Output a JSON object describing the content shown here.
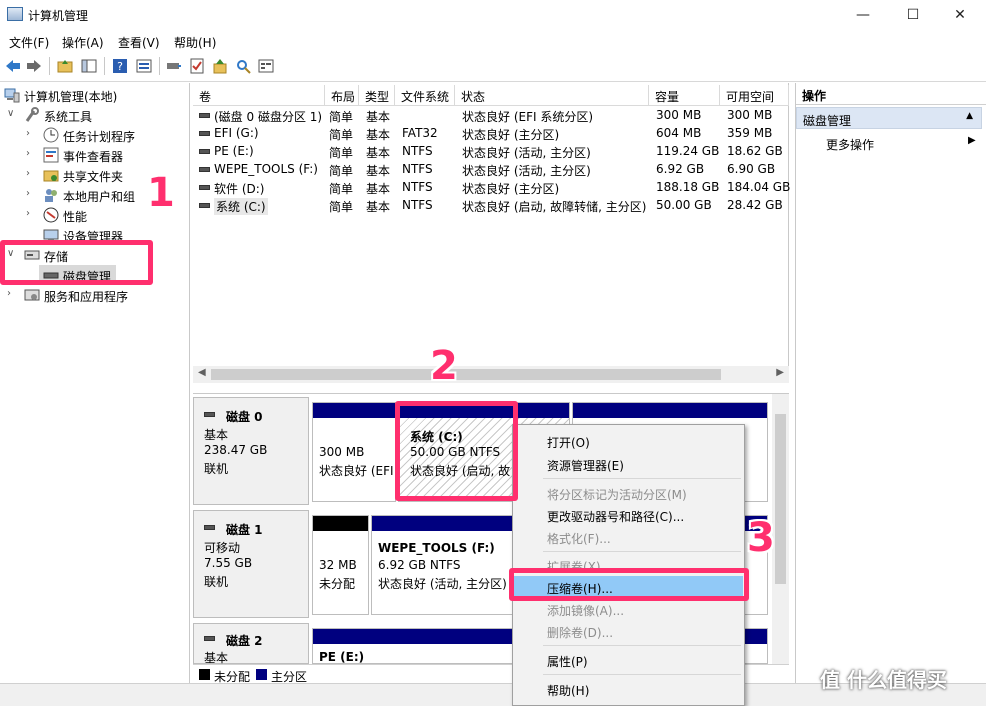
{
  "window": {
    "title": "计算机管理",
    "minimize": "—",
    "maximize": "☐",
    "close": "✕"
  },
  "menu": [
    "文件(F)",
    "操作(A)",
    "查看(V)",
    "帮助(H)"
  ],
  "tree": {
    "root": "计算机管理(本地)",
    "system_tools": "系统工具",
    "task_scheduler": "任务计划程序",
    "event_viewer": "事件查看器",
    "shared_folders": "共享文件夹",
    "local_users": "本地用户和组",
    "performance": "性能",
    "device_manager": "设备管理器",
    "storage": "存储",
    "disk_management": "磁盘管理",
    "services_apps": "服务和应用程序"
  },
  "volume_table": {
    "columns": [
      "卷",
      "布局",
      "类型",
      "文件系统",
      "状态",
      "容量",
      "可用空间"
    ],
    "rows": [
      [
        "(磁盘 0 磁盘分区 1)",
        "简单",
        "基本",
        "",
        "状态良好 (EFI 系统分区)",
        "300 MB",
        "300 MB"
      ],
      [
        "EFI (G:)",
        "简单",
        "基本",
        "FAT32",
        "状态良好 (主分区)",
        "604 MB",
        "359 MB"
      ],
      [
        "PE (E:)",
        "简单",
        "基本",
        "NTFS",
        "状态良好 (活动, 主分区)",
        "119.24 GB",
        "18.62 GB"
      ],
      [
        "WEPE_TOOLS (F:)",
        "简单",
        "基本",
        "NTFS",
        "状态良好 (活动, 主分区)",
        "6.92 GB",
        "6.90 GB"
      ],
      [
        "软件 (D:)",
        "简单",
        "基本",
        "NTFS",
        "状态良好 (主分区)",
        "188.18 GB",
        "184.04 GB"
      ],
      [
        "系统 (C:)",
        "简单",
        "基本",
        "NTFS",
        "状态良好 (启动, 故障转储, 主分区)",
        "50.00 GB",
        "28.42 GB"
      ]
    ]
  },
  "disks": [
    {
      "name": "磁盘 0",
      "type": "基本",
      "size": "238.47 GB",
      "status": "联机",
      "partitions": [
        {
          "line1": "",
          "line2": "300 MB",
          "line3": "状态良好 (EFI"
        },
        {
          "line1": "系统  (C:)",
          "line2": "50.00 GB NTFS",
          "line3": "状态良好 (启动, 故"
        }
      ]
    },
    {
      "name": "磁盘 1",
      "type": "可移动",
      "size": "7.55 GB",
      "status": "联机",
      "partitions": [
        {
          "line1": "",
          "line2": "32 MB",
          "line3": "未分配"
        },
        {
          "line1": "WEPE_TOOLS  (F:)",
          "line2": "6.92 GB NTFS",
          "line3": "状态良好 (活动, 主分区)"
        }
      ]
    },
    {
      "name": "磁盘 2",
      "type": "基本",
      "partitions": [
        {
          "line1": "PE  (E:)"
        }
      ]
    }
  ],
  "legend": {
    "unallocated": "未分配",
    "primary": "主分区"
  },
  "actions": {
    "header": "操作",
    "section": "磁盘管理",
    "more": "更多操作"
  },
  "context_menu": [
    {
      "label": "打开(O)",
      "enabled": true
    },
    {
      "label": "资源管理器(E)",
      "enabled": true
    },
    {
      "label": "将分区标记为活动分区(M)",
      "enabled": false
    },
    {
      "label": "更改驱动器号和路径(C)...",
      "enabled": true
    },
    {
      "label": "格式化(F)...",
      "enabled": false
    },
    {
      "label": "扩展卷(X)...",
      "enabled": false
    },
    {
      "label": "压缩卷(H)...",
      "enabled": true
    },
    {
      "label": "添加镜像(A)...",
      "enabled": false
    },
    {
      "label": "删除卷(D)...",
      "enabled": false
    },
    {
      "label": "属性(P)",
      "enabled": true
    },
    {
      "label": "帮助(H)",
      "enabled": true
    }
  ],
  "annotations": {
    "step1": "1",
    "step2": "2",
    "step3": "3"
  },
  "watermark": "值 什么值得买",
  "colors": {
    "primary_partition": "#00007f",
    "unallocated": "#000000",
    "highlight": "#91c9f7",
    "annotation": "#ff2f6e"
  }
}
